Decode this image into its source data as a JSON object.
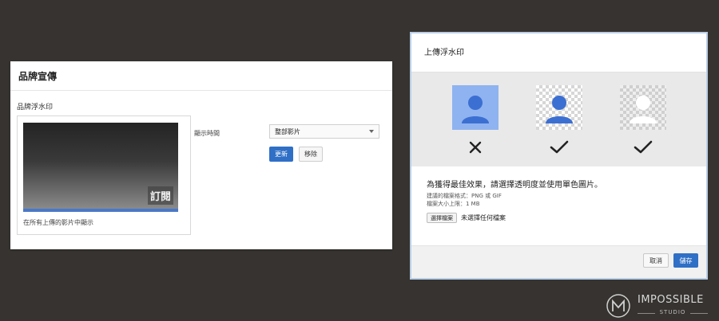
{
  "left": {
    "header": "品牌宣傳",
    "section_title": "品牌浮水印",
    "watermark_text": "訂閱",
    "preview_caption": "在所有上傳的影片中顯示",
    "display_time_label": "顯示時間",
    "display_time_value": "整部影片",
    "update_label": "更新",
    "remove_label": "移除"
  },
  "dialog": {
    "title": "上傳浮水印",
    "guidance": "為獲得最佳效果，請選擇透明度並使用單色圖片。",
    "formats": "建議的檔案格式：PNG 或 GIF",
    "size_limit": "檔案大小上限：1 MB",
    "choose_file_label": "選擇檔案",
    "no_file_label": "未選擇任何檔案",
    "cancel_label": "取消",
    "save_label": "儲存",
    "examples": [
      {
        "icon": "avatar-icon",
        "background": "#8fb3f0",
        "figure": "#3c6fd2",
        "result": "x-mark-icon"
      },
      {
        "icon": "avatar-icon",
        "background": "checkerboard",
        "figure": "#3c6fd2",
        "result": "check-mark-icon"
      },
      {
        "icon": "avatar-icon",
        "background": "checkerboard",
        "figure": "#ffffff",
        "result": "check-mark-icon"
      }
    ]
  },
  "brand": {
    "name": "IMPOSSIBLE",
    "sub": "STUDIO"
  },
  "colors": {
    "background": "#363330",
    "primary_button": "#2f6fc6",
    "progress": "#4a78c8"
  }
}
